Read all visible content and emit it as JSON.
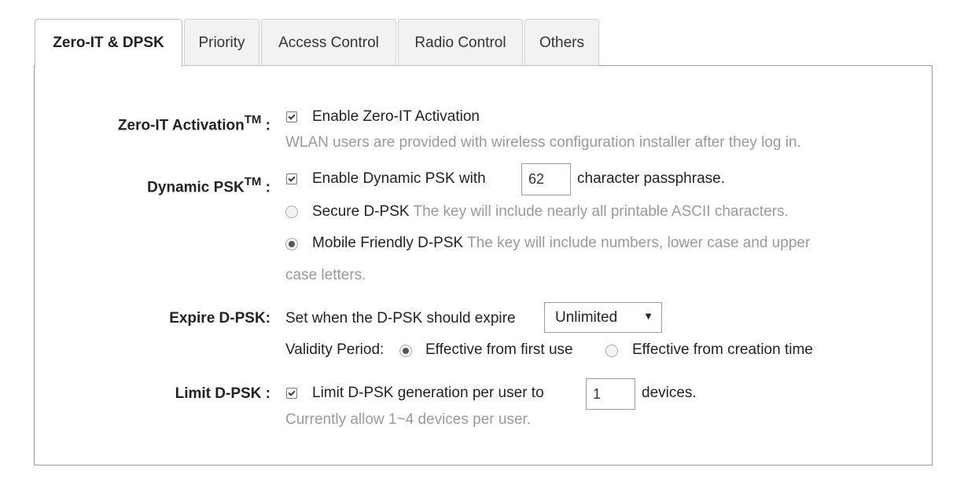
{
  "tabs": [
    {
      "label": "Zero-IT & DPSK",
      "active": true
    },
    {
      "label": "Priority",
      "active": false
    },
    {
      "label": "Access Control",
      "active": false
    },
    {
      "label": "Radio Control",
      "active": false
    },
    {
      "label": "Others",
      "active": false
    }
  ],
  "zero_it": {
    "label": "Zero-IT Activation",
    "tm": "TM",
    "colon": ":",
    "checkbox_label": "Enable Zero-IT Activation",
    "checked": true,
    "help": "WLAN users are provided with wireless configuration installer after they log in."
  },
  "dynamic_psk": {
    "label": "Dynamic PSK",
    "tm": "TM",
    "colon": ":",
    "checkbox_label": "Enable Dynamic PSK with",
    "checked": true,
    "passphrase_length": "62",
    "suffix": "character passphrase.",
    "options": [
      {
        "title": "Secure D-PSK",
        "desc": "The key will include nearly all printable ASCII characters.",
        "selected": false
      },
      {
        "title": "Mobile Friendly D-PSK",
        "desc": "The key will include numbers, lower case and upper",
        "desc_cont": "case letters.",
        "selected": true
      }
    ]
  },
  "expire": {
    "label": "Expire D-PSK:",
    "prompt": "Set when the D-PSK should expire",
    "selected": "Unlimited",
    "arrow": "▼",
    "validity_label": "Validity Period:",
    "validity_options": [
      {
        "label": "Effective from first use",
        "selected": true
      },
      {
        "label": "Effective from creation time",
        "selected": false
      }
    ]
  },
  "limit": {
    "label": "Limit D-PSK :",
    "checkbox_label": "Limit D-PSK generation per user to",
    "checked": true,
    "value": "1",
    "suffix": "devices.",
    "help": "Currently allow 1~4 devices per user."
  }
}
